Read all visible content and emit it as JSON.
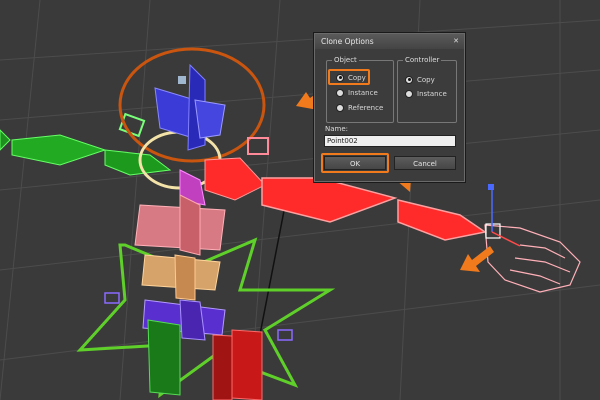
{
  "dialog": {
    "title": "Clone Options",
    "object_group": {
      "label": "Object",
      "options": [
        "Copy",
        "Instance",
        "Reference"
      ],
      "selected": "Copy"
    },
    "controller_group": {
      "label": "Controller",
      "options": [
        "Copy",
        "Instance"
      ],
      "selected": "Copy"
    },
    "name_label": "Name:",
    "name_value": "Point002",
    "ok_label": "OK",
    "cancel_label": "Cancel",
    "close_glyph": "✕"
  },
  "colors": {
    "viewport_bg": "#3a3a3a",
    "highlight": "#f07a1c",
    "arm_red": "#ff2a2a",
    "arm_green": "#22aa22"
  }
}
